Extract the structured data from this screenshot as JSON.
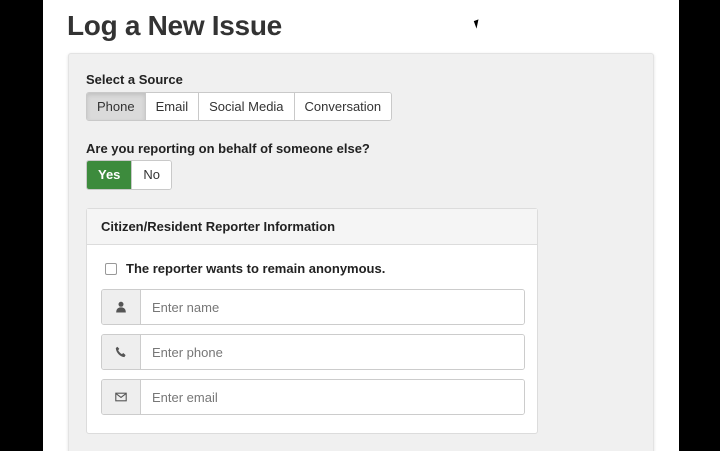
{
  "page": {
    "title": "Log a New Issue"
  },
  "source": {
    "label": "Select a Source",
    "options": [
      "Phone",
      "Email",
      "Social Media",
      "Conversation"
    ],
    "selected": "Phone"
  },
  "behalf": {
    "question": "Are you reporting on behalf of someone else?",
    "yes_label": "Yes",
    "no_label": "No",
    "selected": "Yes"
  },
  "reporter_panel": {
    "heading": "Citizen/Resident Reporter Information",
    "anonymous_label": "The reporter wants to remain anonymous.",
    "name_placeholder": "Enter name",
    "phone_placeholder": "Enter phone",
    "email_placeholder": "Enter email",
    "icons": {
      "name": "user-icon",
      "phone": "phone-icon",
      "email": "envelope-icon"
    }
  },
  "colors": {
    "success": "#3d8b3d",
    "well": "#f0f0f0",
    "active_button": "#dadada"
  }
}
